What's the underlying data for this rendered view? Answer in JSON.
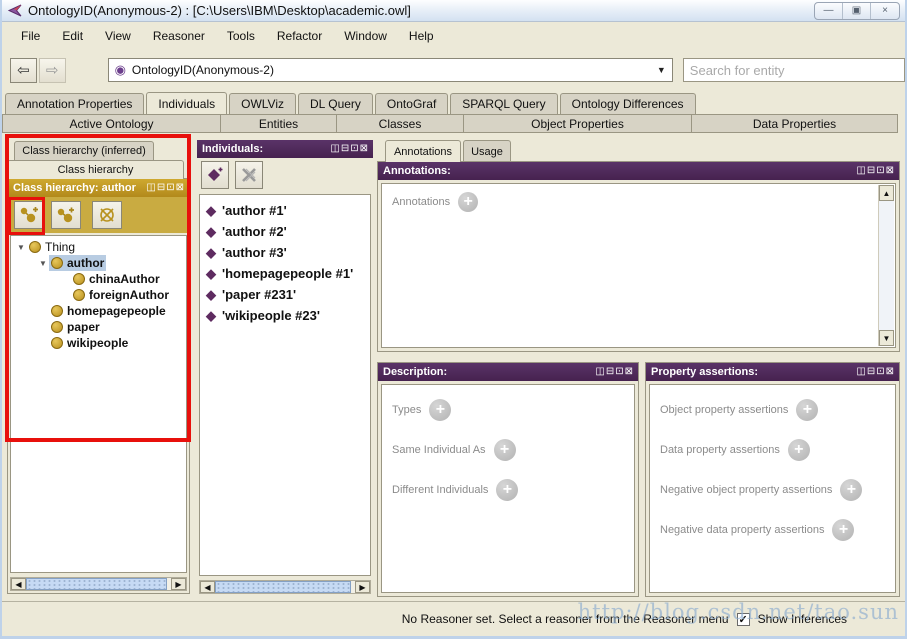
{
  "titlebar": {
    "title": "OntologyID(Anonymous-2) : [C:\\Users\\IBM\\Desktop\\academic.owl]"
  },
  "menu": {
    "items": [
      "File",
      "Edit",
      "View",
      "Reasoner",
      "Tools",
      "Refactor",
      "Window",
      "Help"
    ]
  },
  "toolbar": {
    "ontology_selector_value": "OntologyID(Anonymous-2)",
    "search_placeholder": "Search for entity"
  },
  "tab_rows": {
    "row1": [
      "Annotation Properties",
      "Individuals",
      "OWLViz",
      "DL Query",
      "OntoGraf",
      "SPARQL Query",
      "Ontology Differences"
    ],
    "row1_active": "Individuals",
    "row2": [
      "Active Ontology",
      "Entities",
      "Classes",
      "Object Properties",
      "Data Properties"
    ]
  },
  "class_panel": {
    "tab_inferred": "Class hierarchy (inferred)",
    "tab_asserted": "Class hierarchy",
    "header": "Class hierarchy: author",
    "tree": [
      {
        "label": "Thing",
        "level": 0,
        "expanded": true,
        "selected": false
      },
      {
        "label": "author",
        "level": 1,
        "expanded": true,
        "selected": true
      },
      {
        "label": "chinaAuthor",
        "level": 2,
        "expanded": false,
        "selected": false
      },
      {
        "label": "foreignAuthor",
        "level": 2,
        "expanded": false,
        "selected": false
      },
      {
        "label": "homepagepeople",
        "level": 1,
        "expanded": false,
        "selected": false
      },
      {
        "label": "paper",
        "level": 1,
        "expanded": false,
        "selected": false
      },
      {
        "label": "wikipeople",
        "level": 1,
        "expanded": false,
        "selected": false
      }
    ]
  },
  "individuals_panel": {
    "header": "Individuals:",
    "items": [
      "'author #1'",
      "'author #2'",
      "'author #3'",
      "'homepagepeople #1'",
      "'paper #231'",
      "'wikipeople #23'"
    ]
  },
  "annotations_section": {
    "tab_annotations": "Annotations",
    "tab_usage": "Usage",
    "header": "Annotations:",
    "empty_row_label": "Annotations"
  },
  "description_panel": {
    "header": "Description:",
    "rows": [
      "Types",
      "Same Individual As",
      "Different Individuals"
    ]
  },
  "assertions_panel": {
    "header": "Property assertions:",
    "rows": [
      "Object property assertions",
      "Data property assertions",
      "Negative object property assertions",
      "Negative data property assertions"
    ]
  },
  "status_bar": {
    "message": "No Reasoner set. Select a reasoner from the Reasoner menu",
    "show_inferences_label": "Show Inferences",
    "show_inferences_checked": true,
    "watermark": "http://blog.csdn.net/tao.sun"
  },
  "icons": {
    "minimize": "—",
    "maximize": "▣",
    "close": "×",
    "back": "⇦",
    "forward": "⇨",
    "dropdown": "▼",
    "ontology": "◉",
    "win_split": "◫",
    "win_minimize": "⊟",
    "win_float": "⊡",
    "win_close": "⊠",
    "triangle": "▼",
    "check": "✓",
    "plus": "+",
    "diamond": "◆",
    "scroll_left": "◀",
    "scroll_right": "▶",
    "scroll_up": "▲",
    "scroll_down": "▼"
  },
  "colors": {
    "gold_header": "#bb8f20",
    "purple_header": "#4e2a5e",
    "selection_blue": "#b8cce2",
    "annotation_red": "#e8100c",
    "diamond_purple": "#5e2b60",
    "class_ball_gold": "#c49a24"
  }
}
